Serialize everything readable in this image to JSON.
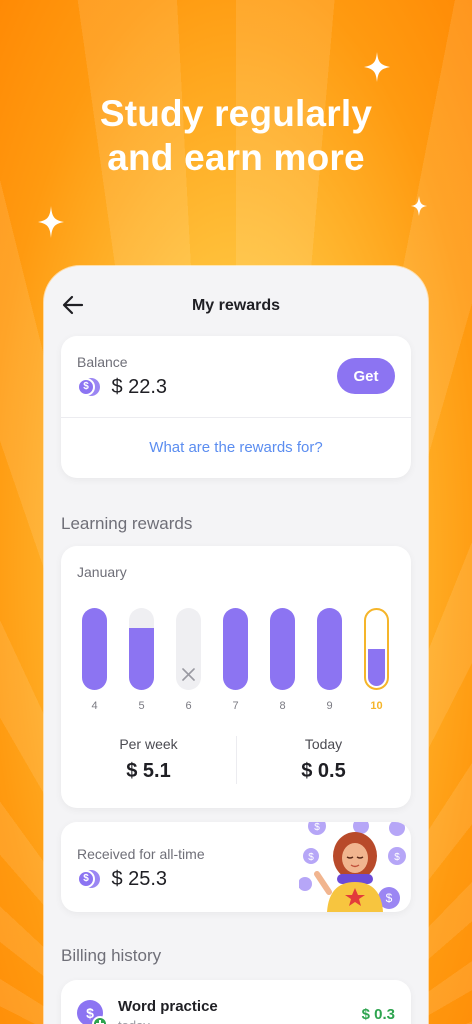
{
  "headline": {
    "line1": "Study regularly",
    "line2": "and earn more"
  },
  "screen": {
    "title": "My rewards"
  },
  "balance": {
    "label": "Balance",
    "amount": "$ 22.3",
    "get_label": "Get",
    "link": "What are the rewards for?"
  },
  "learning": {
    "section_title": "Learning rewards",
    "month": "January",
    "days": [
      {
        "label": "4",
        "fill": 1.0,
        "state": "complete"
      },
      {
        "label": "5",
        "fill": 0.75,
        "state": "partial"
      },
      {
        "label": "6",
        "fill": 0.0,
        "state": "missed"
      },
      {
        "label": "7",
        "fill": 1.0,
        "state": "complete"
      },
      {
        "label": "8",
        "fill": 1.0,
        "state": "complete"
      },
      {
        "label": "9",
        "fill": 1.0,
        "state": "complete"
      },
      {
        "label": "10",
        "fill": 0.5,
        "state": "today"
      }
    ],
    "per_week_label": "Per week",
    "per_week_value": "$ 5.1",
    "today_label": "Today",
    "today_value": "$ 0.5"
  },
  "alltime": {
    "label": "Received for all-time",
    "amount": "$ 25.3"
  },
  "billing": {
    "section_title": "Billing history",
    "items": [
      {
        "title": "Word practice",
        "subtitle": "today",
        "amount": "$ 0.3"
      }
    ]
  },
  "colors": {
    "accent": "#8c74f2",
    "today": "#f5b52a",
    "link": "#5b8df0",
    "positive": "#2ea44f"
  }
}
